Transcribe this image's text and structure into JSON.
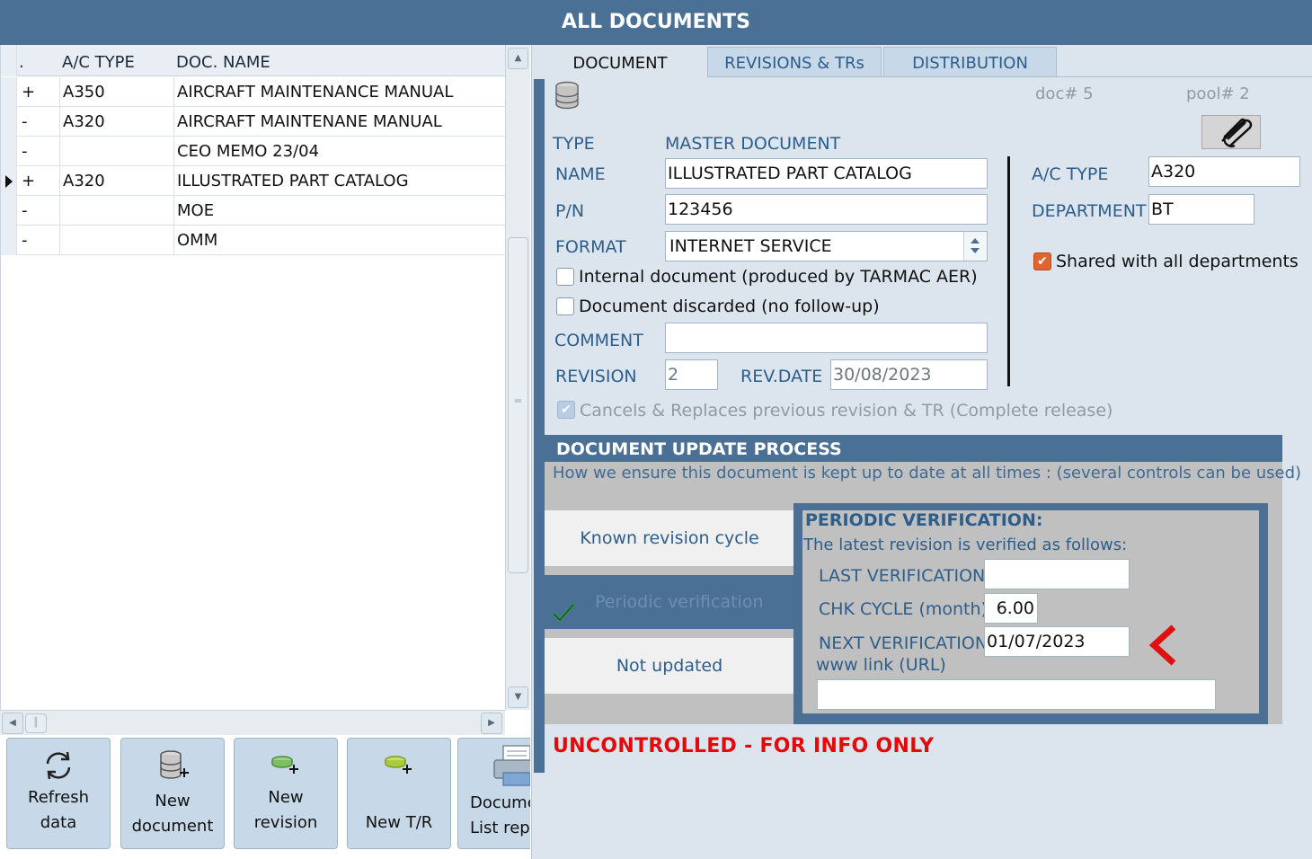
{
  "window": {
    "title": "ALL DOCUMENTS"
  },
  "grid": {
    "columns": [
      ".",
      "A/C TYPE",
      "DOC. NAME"
    ],
    "rows": [
      {
        "sign": "+",
        "ac_type": "A350",
        "doc_name": "AIRCRAFT MAINTENANCE MANUAL",
        "selected": false
      },
      {
        "sign": "-",
        "ac_type": "A320",
        "doc_name": "AIRCRAFT MAINTENANE MANUAL",
        "selected": false
      },
      {
        "sign": "-",
        "ac_type": "",
        "doc_name": "CEO MEMO 23/04",
        "selected": false
      },
      {
        "sign": "+",
        "ac_type": "A320",
        "doc_name": "ILLUSTRATED PART CATALOG",
        "selected": true
      },
      {
        "sign": "-",
        "ac_type": "",
        "doc_name": "MOE",
        "selected": false
      },
      {
        "sign": "-",
        "ac_type": "",
        "doc_name": "OMM",
        "selected": false
      }
    ],
    "scroll_glyphs": {
      "up": "▲",
      "down": "▼",
      "left": "◀",
      "right": "▶",
      "grip_v": "═",
      "grip_h": "║"
    }
  },
  "toolbar": {
    "refresh": {
      "label": "Refresh data",
      "icon": "refresh-icon"
    },
    "new_document": {
      "label_line1": "New",
      "label_line2": "document",
      "icon": "database-add-icon"
    },
    "new_revision": {
      "label": "New revision",
      "icon": "disc-add-icon"
    },
    "new_tr": {
      "label": "New T/R",
      "icon": "disc-add-icon"
    },
    "report": {
      "label_line1": "Docume",
      "label_line2": "List repo",
      "icon": "printer-icon"
    }
  },
  "tabs": {
    "document": "DOCUMENT",
    "revisions": "REVISIONS & TRs",
    "distribution": "DISTRIBUTION"
  },
  "document": {
    "doc_no": "doc#  5",
    "pool_no": "pool#  2",
    "type_label": "TYPE",
    "type_value": "MASTER DOCUMENT",
    "name_label": "NAME",
    "name_value": "ILLUSTRATED PART CATALOG",
    "pn_label": "P/N",
    "pn_value": "123456",
    "format_label": "FORMAT",
    "format_value": "INTERNET SERVICE",
    "internal_label": "Internal document (produced by TARMAC AER)",
    "internal_checked": false,
    "discarded_label": "Document discarded (no follow-up)",
    "discarded_checked": false,
    "comment_label": "COMMENT",
    "comment_value": "",
    "revision_label": "REVISION",
    "revision_value": "2",
    "revdate_label": "REV.DATE",
    "revdate_value": "30/08/2023",
    "cancels_label": "Cancels & Replaces previous revision & TR (Complete release)",
    "cancels_checked": true,
    "ac_type_label": "A/C TYPE",
    "ac_type_value": "A320",
    "department_label": "DEPARTMENT",
    "department_value": "BT",
    "shared_label": "Shared with all departments",
    "shared_checked": true
  },
  "update_process": {
    "heading": "DOCUMENT UPDATE PROCESS",
    "intro": "How we ensure this document is kept up to date at all times :  (several controls can be used)",
    "options": {
      "known_cycle": "Known revision cycle",
      "periodic": "Periodic verification",
      "not_updated": "Not updated"
    },
    "periodic": {
      "title": "PERIODIC VERIFICATION:",
      "subtitle": "The latest revision is verified as follows:",
      "last_label": "LAST VERIFICATION",
      "last_value": "",
      "cycle_label": "CHK CYCLE (month)",
      "cycle_value": "6.00",
      "next_label": "NEXT VERIFICATION",
      "next_value": "01/07/2023",
      "url_label": "www link (URL)",
      "url_value": ""
    }
  },
  "footer": {
    "uncontrolled": "UNCONTROLLED  - FOR INFO ONLY"
  },
  "colors": {
    "header_blue": "#4a7096",
    "label_blue": "#2d5d8a",
    "warning_red": "#e20a0a",
    "check_orange": "#e2642f"
  }
}
